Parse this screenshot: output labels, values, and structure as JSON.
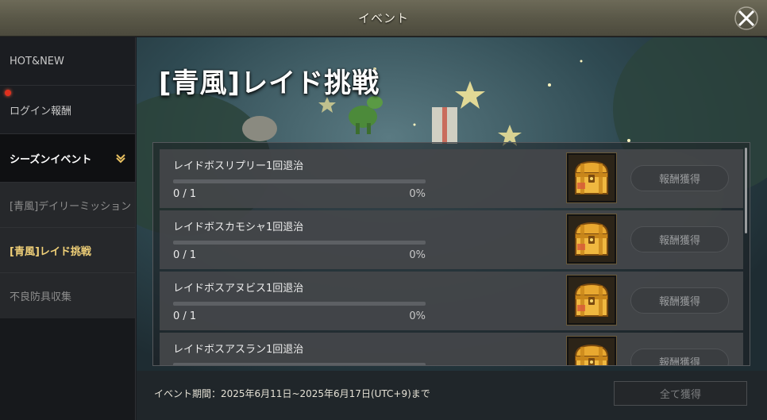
{
  "window": {
    "title": "イベント",
    "close_icon": "close-icon"
  },
  "sidebar": {
    "items": [
      {
        "label": "HOT&NEW",
        "has_badge": false
      },
      {
        "label": "ログイン報酬",
        "has_badge": true
      },
      {
        "label": "シーズンイベント",
        "expanded": true,
        "icon": "chevron-down-icon"
      }
    ],
    "sub_items": [
      {
        "label": "[青風]デイリーミッション",
        "selected": false
      },
      {
        "label": "[青風]レイド挑戦",
        "selected": true
      },
      {
        "label": "不良防具収集",
        "selected": false
      }
    ]
  },
  "main": {
    "title": "[青風]レイド挑戦",
    "missions": [
      {
        "name": "レイドボスリプリー1回退治",
        "count": "0 / 1",
        "percent": "0%",
        "progress": 0,
        "reward_icon": "treasure-chest-icon",
        "claim_label": "報酬獲得"
      },
      {
        "name": "レイドボスカモシャ1回退治",
        "count": "0 / 1",
        "percent": "0%",
        "progress": 0,
        "reward_icon": "treasure-chest-icon",
        "claim_label": "報酬獲得"
      },
      {
        "name": "レイドボスアヌビス1回退治",
        "count": "0 / 1",
        "percent": "0%",
        "progress": 0,
        "reward_icon": "treasure-chest-icon",
        "claim_label": "報酬獲得"
      },
      {
        "name": "レイドボスアスラン1回退治",
        "count": "0 / 1",
        "percent": "0%",
        "progress": 0,
        "reward_icon": "treasure-chest-icon",
        "claim_label": "報酬獲得"
      }
    ]
  },
  "footer": {
    "period": "イベント期間：2025年6月11日~2025年6月17日(UTC+9)まで",
    "claim_all_label": "全て獲得"
  },
  "colors": {
    "accent_gold": "#f0d078",
    "badge_red": "#e0301e"
  }
}
